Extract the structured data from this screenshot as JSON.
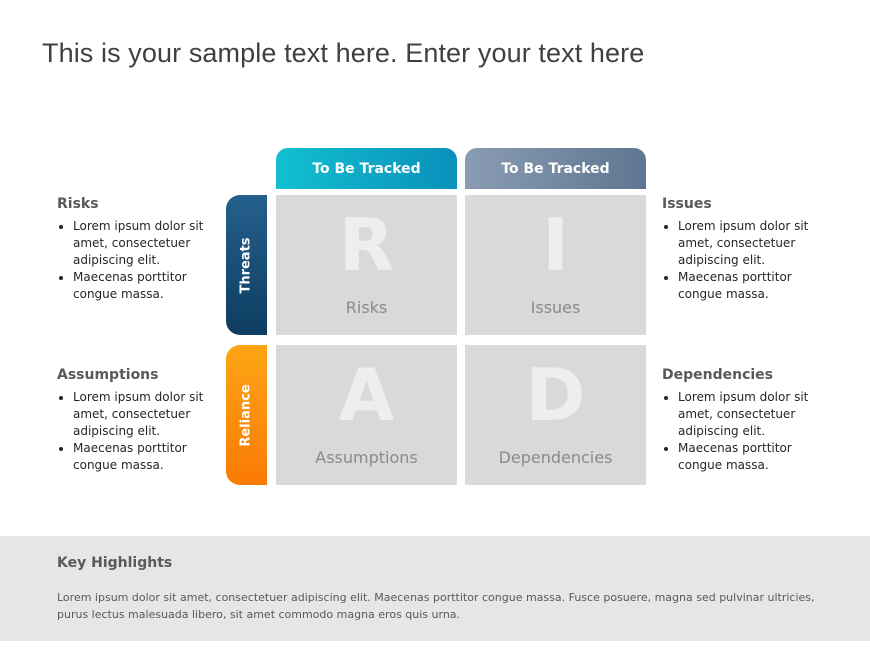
{
  "title": "This is your sample text here. Enter your text here",
  "columns": [
    {
      "label": "To Be Tracked",
      "color_start": "#12bfd0",
      "color_end": "#0a90bb"
    },
    {
      "label": "To Be Tracked",
      "color_start": "#8a9cb2",
      "color_end": "#5e7691"
    }
  ],
  "rows": [
    {
      "label": "Threats",
      "color_start": "#24608c",
      "color_end": "#0e3d62"
    },
    {
      "label": "Reliance",
      "color_start": "#fca515",
      "color_end": "#fa7a05"
    }
  ],
  "quadrants": [
    {
      "letter": "R",
      "label": "Risks"
    },
    {
      "letter": "I",
      "label": "Issues"
    },
    {
      "letter": "A",
      "label": "Assumptions"
    },
    {
      "letter": "D",
      "label": "Dependencies"
    }
  ],
  "side_notes": {
    "risks": {
      "heading": "Risks",
      "bullets": [
        "Lorem ipsum dolor sit amet, consectetuer adipiscing elit.",
        "Maecenas porttitor congue massa."
      ]
    },
    "issues": {
      "heading": "Issues",
      "bullets": [
        "Lorem ipsum dolor sit amet, consectetuer adipiscing elit.",
        "Maecenas porttitor congue massa."
      ]
    },
    "assumptions": {
      "heading": "Assumptions",
      "bullets": [
        "Lorem ipsum dolor sit amet, consectetuer adipiscing elit.",
        "Maecenas porttitor congue massa."
      ]
    },
    "dependencies": {
      "heading": "Dependencies",
      "bullets": [
        "Lorem ipsum dolor sit amet, consectetuer adipiscing elit.",
        "Maecenas porttitor congue massa."
      ]
    }
  },
  "highlights": {
    "heading": "Key Highlights",
    "body": "Lorem ipsum dolor sit amet, consectetuer adipiscing elit. Maecenas porttitor congue massa. Fusce posuere, magna sed pulvinar ultricies, purus lectus malesuada libero, sit amet commodo magna eros quis urna."
  }
}
